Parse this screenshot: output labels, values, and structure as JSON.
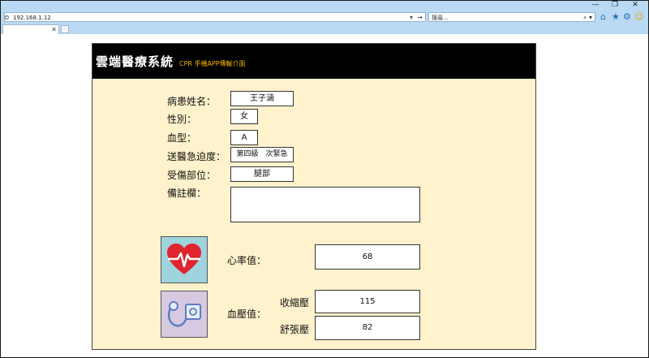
{
  "browser": {
    "address": "192.168.1.12",
    "search_placeholder": "搜尋...",
    "search_icon_label": "⌕ ▾",
    "window_controls": {
      "minimize": "—",
      "restore": "❐",
      "close": "✕"
    }
  },
  "app": {
    "title": "雲端醫療系統",
    "subtitle": "CPR 手機APP傳輸介面"
  },
  "patient": {
    "name_label": "病患姓名：",
    "name_value": "王子涵",
    "gender_label": "性別：",
    "gender_value": "女",
    "blood_type_label": "血型：",
    "blood_type_value": "A",
    "urgency_label": "送醫急迫度：",
    "urgency_value": "第四級　次緊急",
    "injury_label": "受傷部位：",
    "injury_value": "腿部",
    "notes_label": "備註欄：",
    "notes_value": ""
  },
  "vitals": {
    "heart_rate_label": "心率值：",
    "heart_rate_value": "68",
    "blood_pressure_label": "血壓值：",
    "systolic_label": "收縮壓",
    "systolic_value": "115",
    "diastolic_label": "舒張壓",
    "diastolic_value": "82"
  },
  "colors": {
    "panel_bg": "#fff2cc",
    "header_bg": "#000000",
    "subtitle": "#f5b400",
    "heart_icon_bg": "#9fd3de",
    "heart_red": "#e0252e",
    "bp_icon_bg": "#d6c9e0"
  },
  "icons": [
    "heart-rate-icon",
    "blood-pressure-icon"
  ]
}
